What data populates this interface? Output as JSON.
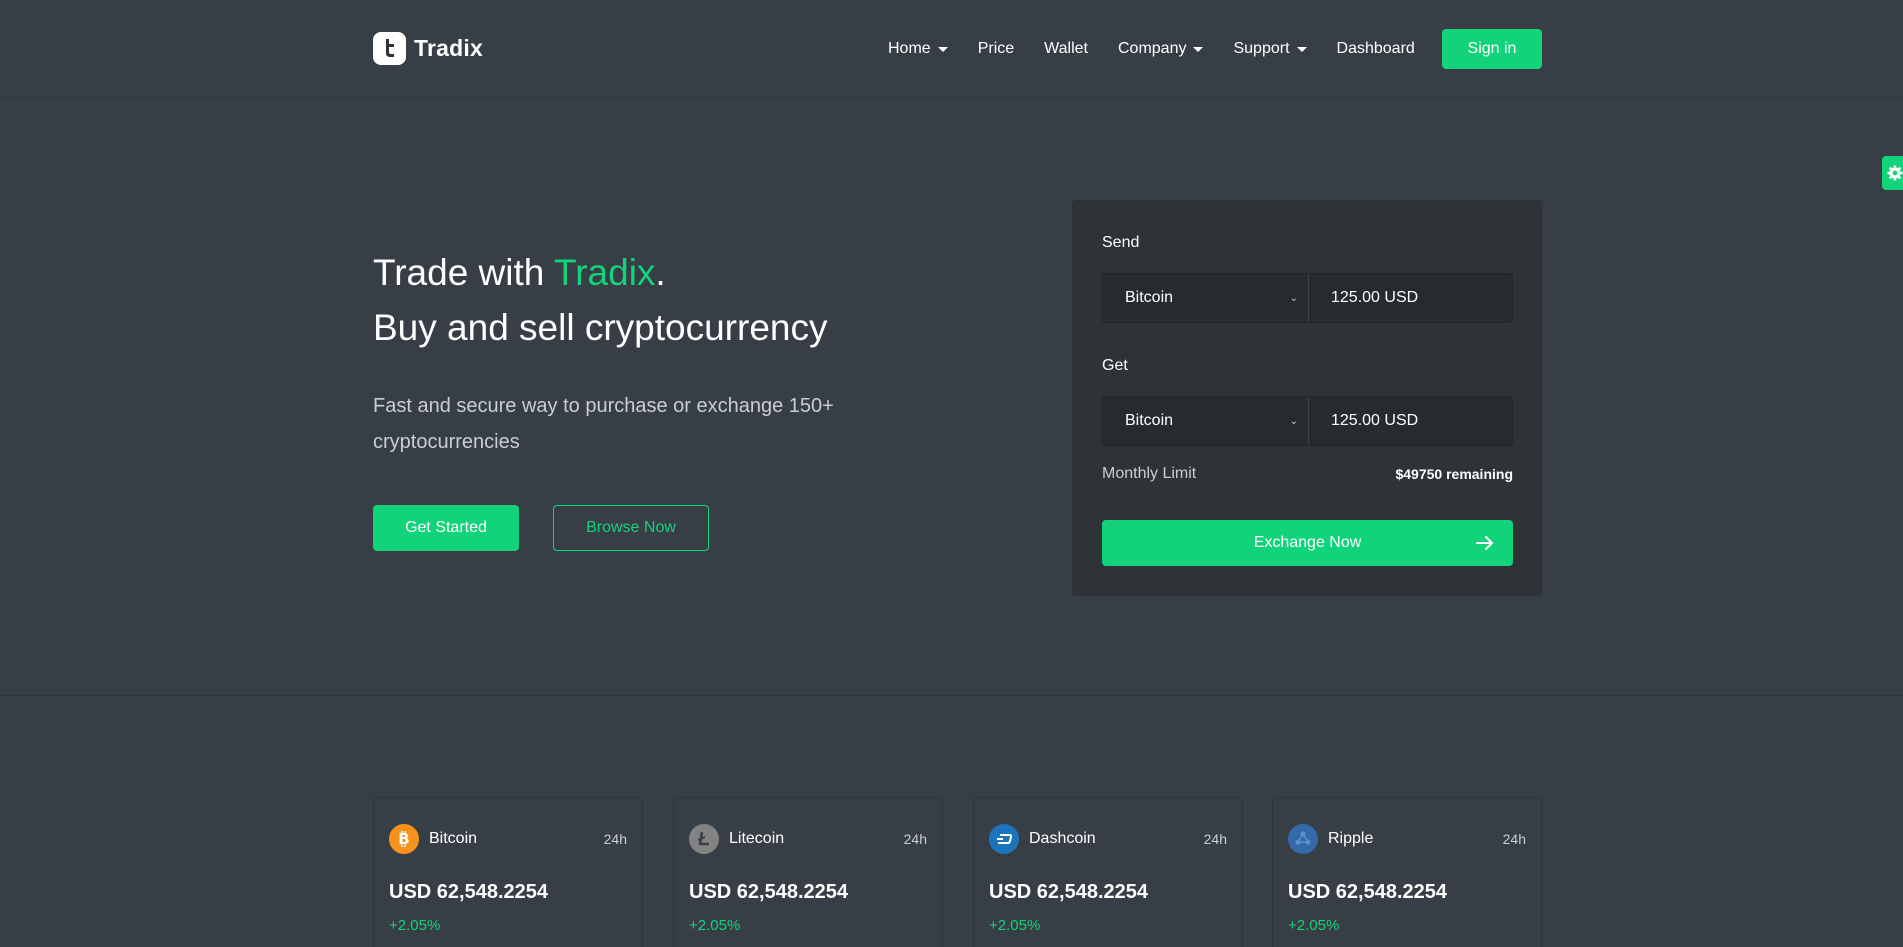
{
  "brand": {
    "name": "Tradix"
  },
  "nav": {
    "items": [
      {
        "label": "Home",
        "dropdown": true
      },
      {
        "label": "Price",
        "dropdown": false
      },
      {
        "label": "Wallet",
        "dropdown": false
      },
      {
        "label": "Company",
        "dropdown": true
      },
      {
        "label": "Support",
        "dropdown": true
      },
      {
        "label": "Dashboard",
        "dropdown": false
      }
    ],
    "signin_label": "Sign in"
  },
  "hero": {
    "title_prefix": "Trade with ",
    "title_accent": "Tradix",
    "title_suffix": ".",
    "title_line2": "Buy and sell cryptocurrency",
    "subtitle": "Fast and secure way to purchase or exchange 150+ cryptocurrencies",
    "primary_button": "Get Started",
    "secondary_button": "Browse Now"
  },
  "exchange": {
    "send_label": "Send",
    "send_currency": "Bitcoin",
    "send_amount": "125.00 USD",
    "get_label": "Get",
    "get_currency": "Bitcoin",
    "get_amount": "125.00 USD",
    "limit_label": "Monthly Limit",
    "limit_value": "$49750 remaining",
    "button_label": "Exchange Now"
  },
  "coins": [
    {
      "name": "Bitcoin",
      "period": "24h",
      "price": "USD 62,548.2254",
      "change": "+2.05%",
      "icon": "bitcoin-icon",
      "color": "#f7931a"
    },
    {
      "name": "Litecoin",
      "period": "24h",
      "price": "USD 62,548.2254",
      "change": "+2.05%",
      "icon": "litecoin-icon",
      "color": "#838383"
    },
    {
      "name": "Dashcoin",
      "period": "24h",
      "price": "USD 62,548.2254",
      "change": "+2.05%",
      "icon": "dashcoin-icon",
      "color": "#1c75bc"
    },
    {
      "name": "Ripple",
      "period": "24h",
      "price": "USD 62,548.2254",
      "change": "+2.05%",
      "icon": "ripple-icon",
      "color": "#346aa9"
    }
  ],
  "colors": {
    "accent": "#13d37a",
    "background": "#373e45",
    "card": "#2e3338"
  }
}
